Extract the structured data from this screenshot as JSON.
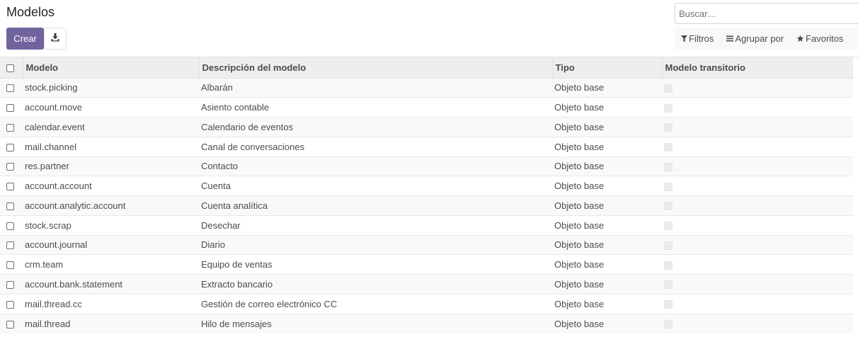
{
  "header": {
    "title": "Modelos",
    "create_label": "Crear",
    "download_icon": "download-icon"
  },
  "search": {
    "placeholder": "Buscar…"
  },
  "filters": [
    {
      "label": "Filtros",
      "icon": "filter-icon"
    },
    {
      "label": "Agrupar por",
      "icon": "list-icon"
    },
    {
      "label": "Favoritos",
      "icon": "star-icon"
    }
  ],
  "table": {
    "columns": [
      "Modelo",
      "Descripción del modelo",
      "Tipo",
      "Modelo transitorio"
    ],
    "rows": [
      {
        "model": "stock.picking",
        "description": "Albarán",
        "type": "Objeto base",
        "transient": false
      },
      {
        "model": "account.move",
        "description": "Asiento contable",
        "type": "Objeto base",
        "transient": false
      },
      {
        "model": "calendar.event",
        "description": "Calendario de eventos",
        "type": "Objeto base",
        "transient": false
      },
      {
        "model": "mail.channel",
        "description": "Canal de conversaciones",
        "type": "Objeto base",
        "transient": false
      },
      {
        "model": "res.partner",
        "description": "Contacto",
        "type": "Objeto base",
        "transient": false
      },
      {
        "model": "account.account",
        "description": "Cuenta",
        "type": "Objeto base",
        "transient": false
      },
      {
        "model": "account.analytic.account",
        "description": "Cuenta analítica",
        "type": "Objeto base",
        "transient": false
      },
      {
        "model": "stock.scrap",
        "description": "Desechar",
        "type": "Objeto base",
        "transient": false
      },
      {
        "model": "account.journal",
        "description": "Diario",
        "type": "Objeto base",
        "transient": false
      },
      {
        "model": "crm.team",
        "description": "Equipo de ventas",
        "type": "Objeto base",
        "transient": false
      },
      {
        "model": "account.bank.statement",
        "description": "Extracto bancario",
        "type": "Objeto base",
        "transient": false
      },
      {
        "model": "mail.thread.cc",
        "description": "Gestión de correo electrónico CC",
        "type": "Objeto base",
        "transient": false
      },
      {
        "model": "mail.thread",
        "description": "Hilo de mensajes",
        "type": "Objeto base",
        "transient": false
      }
    ]
  },
  "colors": {
    "primary": "#71639e",
    "header_bg": "#eeeeee",
    "filter_bg": "#f8f8f8"
  }
}
